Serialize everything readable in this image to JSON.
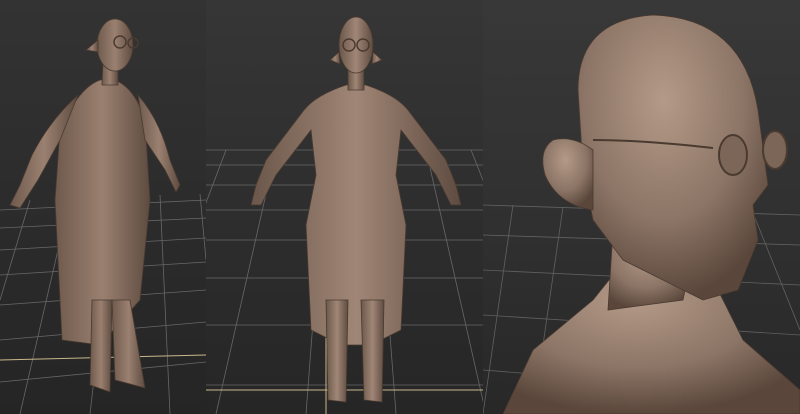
{
  "viewports": [
    {
      "id": "viewport-perspective-left"
    },
    {
      "id": "viewport-front"
    },
    {
      "id": "viewport-closeup"
    }
  ],
  "model": {
    "skin_color": "#8c7566",
    "shadow_color": "#5a463b",
    "highlight_color": "#b49a88"
  },
  "grid": {
    "line_color": "#8a8a8a",
    "axis_color": "#c8b88a",
    "axis_visible": true
  }
}
